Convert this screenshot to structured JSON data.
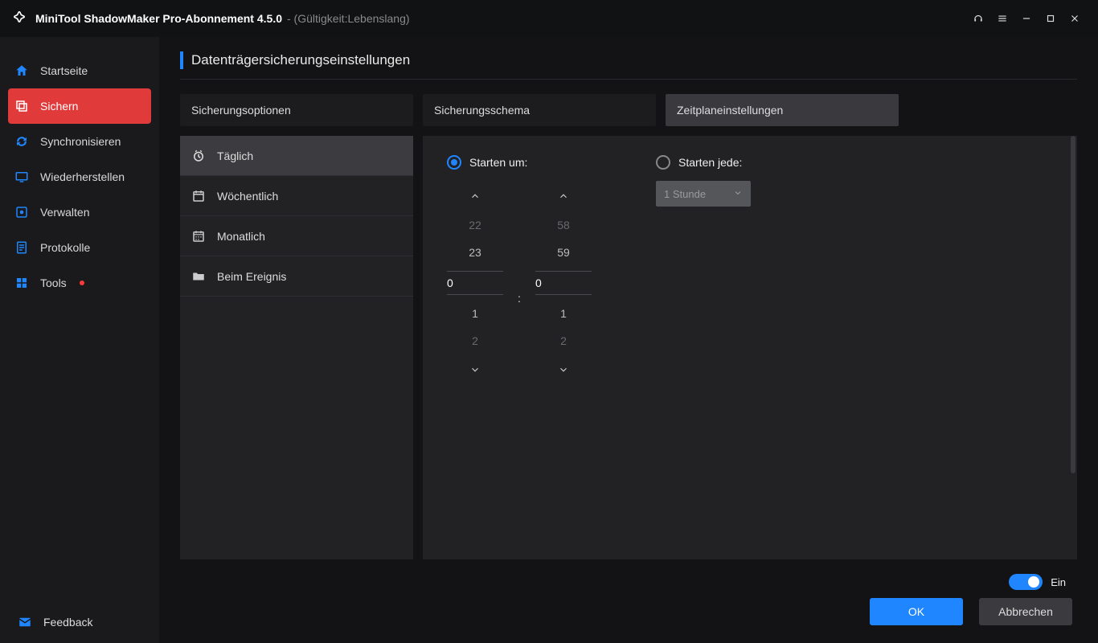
{
  "titlebar": {
    "app_title": "MiniTool ShadowMaker Pro-Abonnement 4.5.0",
    "validity": "- (Gültigkeit:Lebenslang)"
  },
  "sidebar": {
    "items": [
      {
        "label": "Startseite"
      },
      {
        "label": "Sichern"
      },
      {
        "label": "Synchronisieren"
      },
      {
        "label": "Wiederherstellen"
      },
      {
        "label": "Verwalten"
      },
      {
        "label": "Protokolle"
      },
      {
        "label": "Tools"
      }
    ],
    "feedback_label": "Feedback"
  },
  "page": {
    "title": "Datenträgersicherungseinstellungen"
  },
  "tabs": [
    {
      "label": "Sicherungsoptionen"
    },
    {
      "label": "Sicherungsschema"
    },
    {
      "label": "Zeitplaneinstellungen"
    }
  ],
  "frequency": [
    {
      "label": "Täglich"
    },
    {
      "label": "Wöchentlich"
    },
    {
      "label": "Monatlich"
    },
    {
      "label": "Beim Ereignis"
    }
  ],
  "schedule": {
    "start_at_label": "Starten um:",
    "start_every_label": "Starten jede:",
    "every_value": "1 Stunde",
    "hours": {
      "minus2": "22",
      "minus1": "23",
      "selected": "0",
      "plus1": "1",
      "plus2": "2"
    },
    "minutes": {
      "minus2": "58",
      "minus1": "59",
      "selected": "0",
      "plus1": "1",
      "plus2": "2"
    },
    "colon": ":"
  },
  "footer": {
    "toggle_label": "Ein",
    "ok_label": "OK",
    "cancel_label": "Abbrechen"
  }
}
